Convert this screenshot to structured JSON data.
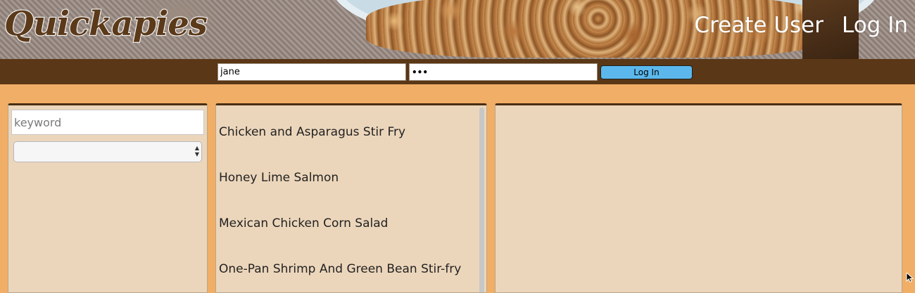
{
  "header": {
    "logo_text": "Quickapies",
    "nav": {
      "create_user": "Create User",
      "log_in": "Log In"
    }
  },
  "login": {
    "username_value": "jane",
    "password_value": "•••",
    "submit_label": "Log In"
  },
  "search": {
    "keyword_placeholder": "keyword",
    "category_selected": ""
  },
  "recipes": {
    "items": [
      "Chicken and Asparagus Stir Fry",
      "Honey Lime Salmon",
      "Mexican Chicken Corn Salad",
      "One-Pan Shrimp And Green Bean Stir-fry"
    ]
  },
  "colors": {
    "page_background": "#f0ae66",
    "login_bar": "#5a3716",
    "panel_background": "#ecd6bb",
    "login_button": "#5cb8ec"
  },
  "icons": {
    "cursor": "cursor-icon",
    "select_arrows": "select-arrows-icon"
  }
}
